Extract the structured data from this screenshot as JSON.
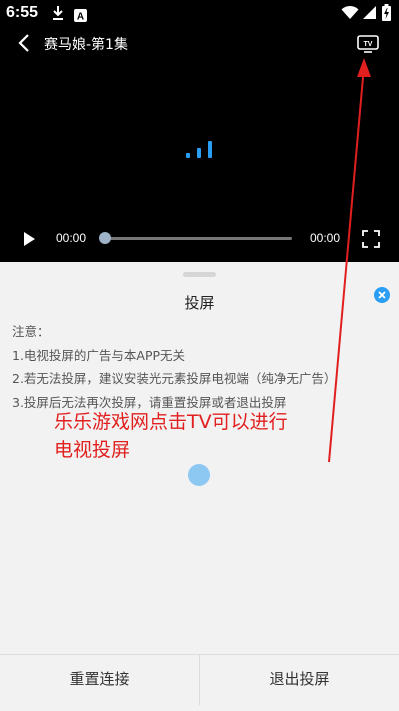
{
  "status_bar": {
    "time": "6:55",
    "icons": [
      "download-icon",
      "app-a-icon",
      "wifi-icon",
      "signal-icon",
      "battery-charging-icon"
    ],
    "a_glyph": "A"
  },
  "player": {
    "title": "赛马娘-第1集",
    "current_time": "00:00",
    "total_time": "00:00",
    "progress": 0,
    "tv_label": "TV",
    "loading_icon": "loading-bars-icon"
  },
  "cast_sheet": {
    "title": "投屏",
    "notes_title": "注意：",
    "notes": [
      "1.电视投屏的广告与本APP无关",
      "2.若无法投屏，建议安装光元素投屏电视端（纯净无广告）",
      "3.投屏后无法再次投屏，请重置投屏或者退出投屏"
    ],
    "reset_label": "重置连接",
    "exit_label": "退出投屏"
  },
  "annotation": {
    "line1": "乐乐游戏网点击TV可以进行",
    "line2": "电视投屏",
    "color": "#e21f1f"
  },
  "colors": {
    "accent": "#2a9df4",
    "video_bg": "#000000",
    "sheet_bg": "#f2f2f2"
  }
}
